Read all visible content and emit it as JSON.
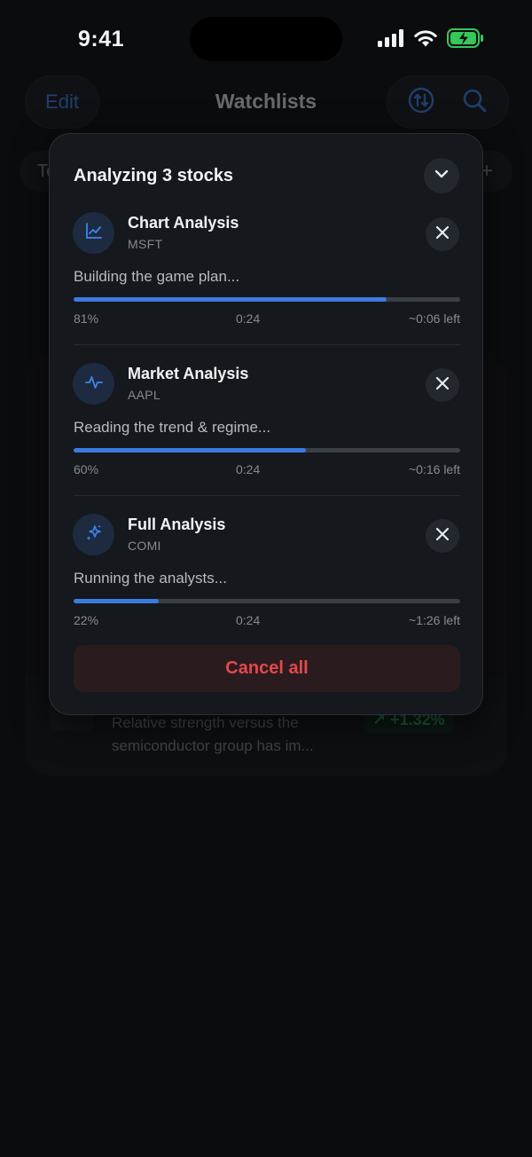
{
  "status_bar": {
    "time": "9:41"
  },
  "background": {
    "edit_label": "Edit",
    "title": "Watchlists",
    "chip_label": "To",
    "plus_label": "+",
    "snippet_line1": "Relative strength versus the",
    "snippet_line2": "semiconductor group has im...",
    "change": "↗ +1.32%"
  },
  "panel": {
    "title": "Analyzing 3 stocks",
    "jobs": [
      {
        "name": "Chart Analysis",
        "ticker": "MSFT",
        "status": "Building the game plan...",
        "progress": 0.81,
        "percent": "81%",
        "elapsed": "0:24",
        "remaining": "~0:06 left",
        "icon": "chart-line-icon"
      },
      {
        "name": "Market Analysis",
        "ticker": "AAPL",
        "status": "Reading the trend & regime...",
        "progress": 0.6,
        "percent": "60%",
        "elapsed": "0:24",
        "remaining": "~0:16 left",
        "icon": "pulse-icon"
      },
      {
        "name": "Full Analysis",
        "ticker": "COMI",
        "status": "Running the analysts...",
        "progress": 0.22,
        "percent": "22%",
        "elapsed": "0:24",
        "remaining": "~1:26 left",
        "icon": "sparkle-icon"
      }
    ],
    "cancel_all": "Cancel all"
  },
  "colors": {
    "accent": "#3a7be0",
    "danger": "#e5484d",
    "positive": "#35c06e"
  }
}
